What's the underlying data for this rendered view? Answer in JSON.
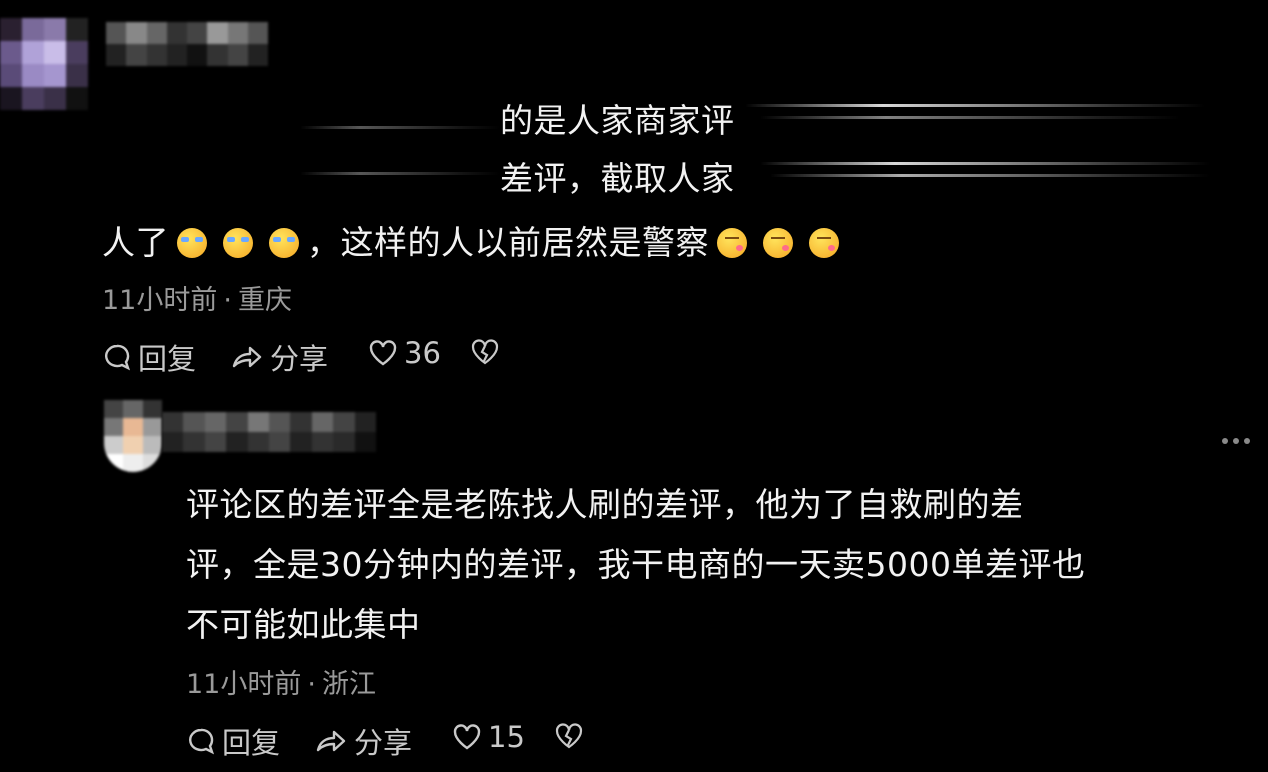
{
  "comment1": {
    "quote_line1": "的是人家商家评",
    "quote_line2": "差评，截取人家",
    "body_prefix": "人了",
    "body_main": "，这样的人以前居然是警察",
    "time": "11小时前",
    "location": "重庆",
    "reply_label": "回复",
    "share_label": "分享",
    "like_count": "36",
    "emojis": [
      "crying-laughing-icon",
      "crying-laughing-icon",
      "crying-laughing-icon"
    ],
    "emojis_tail": [
      "blowing-kiss-icon",
      "blowing-kiss-icon",
      "blowing-kiss-icon"
    ]
  },
  "comment2": {
    "line1": "评论区的差评全是老陈找人刷的差评，他为了自救刷的差",
    "line2": "评，全是30分钟内的差评，我干电商的一天卖5000单差评也",
    "line3": "不可能如此集中",
    "time": "11小时前",
    "location": "浙江",
    "reply_label": "回复",
    "share_label": "分享",
    "like_count": "15"
  },
  "separator": "·",
  "colors": {
    "background": "#000000",
    "text": "#f2f2f2",
    "meta": "#9a9a9a"
  }
}
